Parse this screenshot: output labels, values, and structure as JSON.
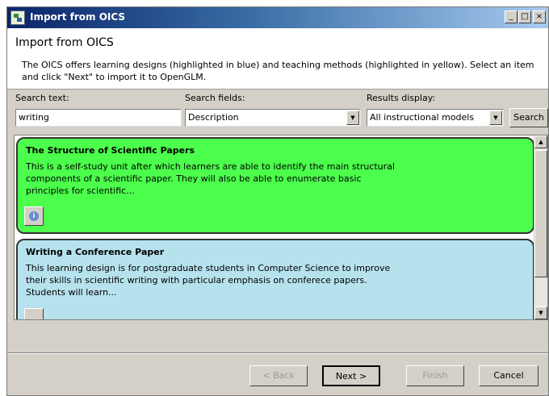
{
  "window": {
    "title": "Import from OICS"
  },
  "titlebar_buttons": {
    "minimize": "_",
    "maximize": "□",
    "close": "×"
  },
  "header": {
    "title": "Import from OICS",
    "description": "The OICS offers learning designs (highlighted in blue) and teaching methods (highlighted in yellow). Select an item and click \"Next\" to import it to OpenGLM."
  },
  "search": {
    "label": "Search text:",
    "value": "writing"
  },
  "fields": {
    "label": "Search fields:",
    "selected": "Description"
  },
  "display": {
    "label": "Results display:",
    "selected": "All instructional models"
  },
  "search_button": "Search",
  "results": [
    {
      "title": "The Structure of Scientific Papers",
      "description": "This is a self-study unit after which learners are able to identify the main structural components of a scientific paper. They will also be able to enumerate basic principles for scientific...",
      "color": "#4cff4c"
    },
    {
      "title": "Writing a Conference Paper",
      "description": "This learning design is for postgraduate students in Computer Science to improve their skills in scientific writing with particular emphasis on conferece papers. Students will learn...",
      "color": "#b6e2ee"
    }
  ],
  "footer": {
    "back": "< Back",
    "next": "Next >",
    "finish": "Finish",
    "cancel": "Cancel"
  },
  "colors": {
    "learning_design": "#b6e2ee",
    "selected_card": "#4cff4c",
    "title_bar": "#0a246a"
  }
}
